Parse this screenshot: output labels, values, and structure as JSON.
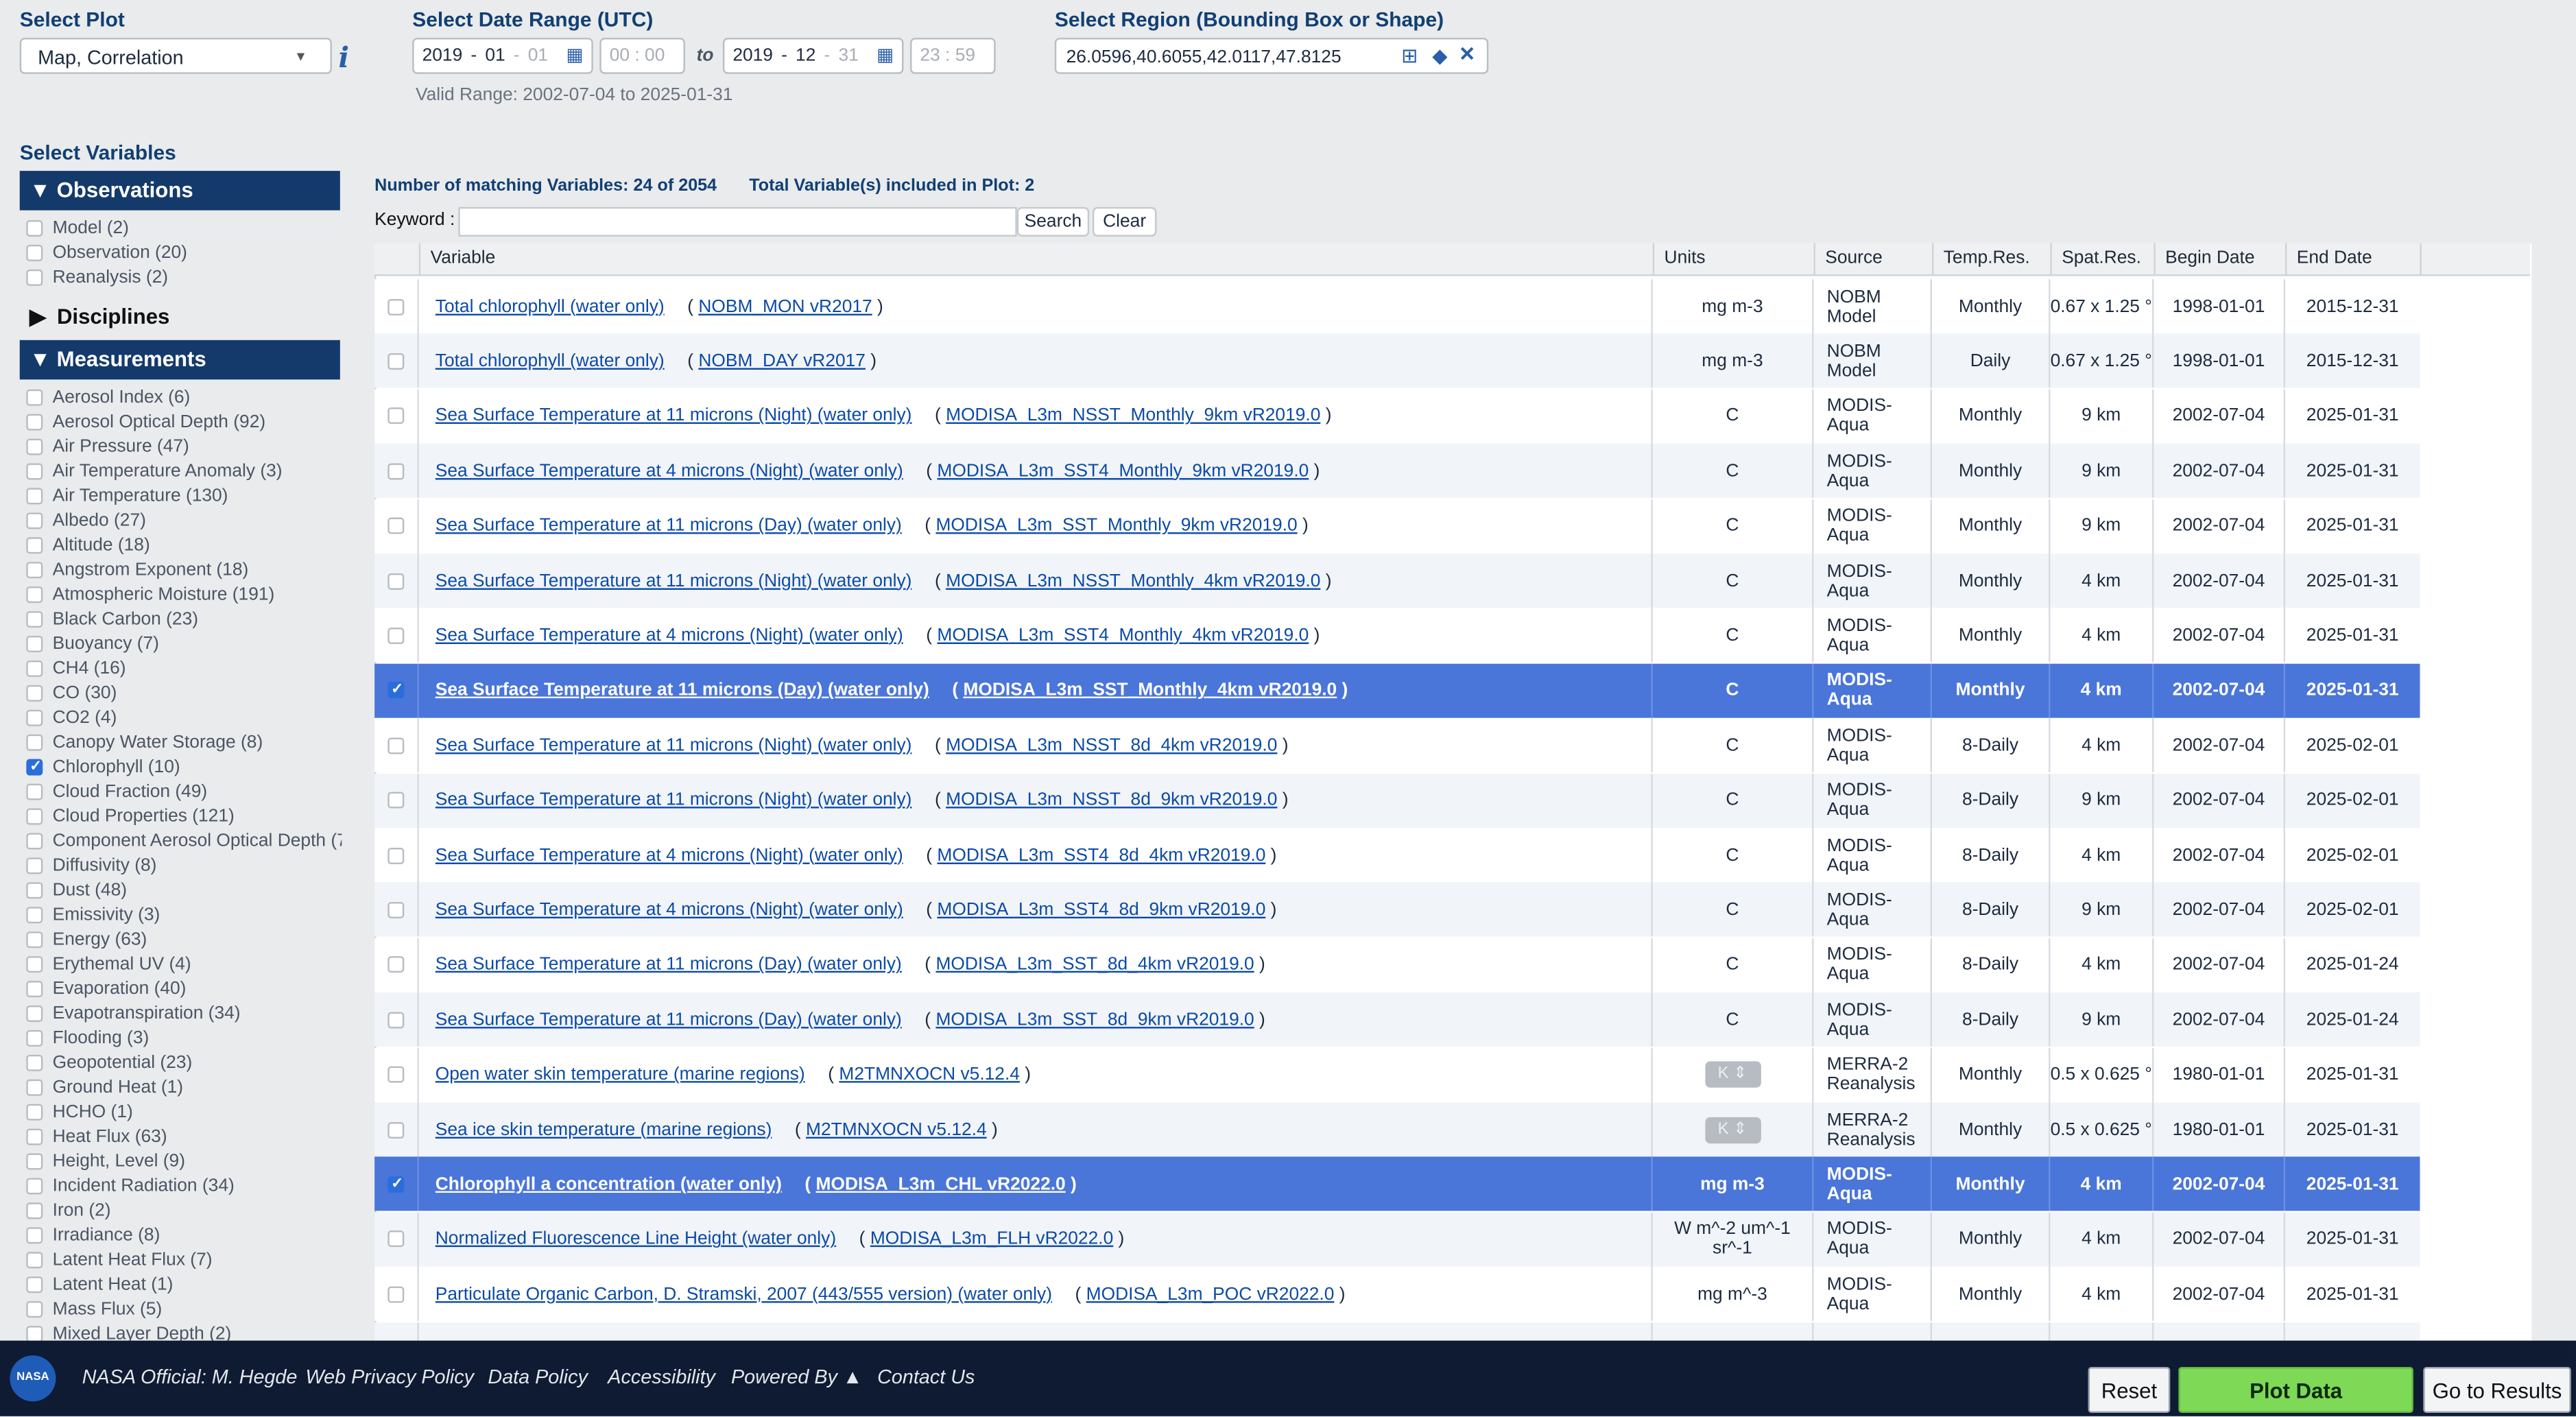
{
  "header": {
    "select_plot_label": "Select Plot",
    "plot_value": "Map, Correlation",
    "date_range_label": "Select Date Range (UTC)",
    "start": {
      "year": "2019",
      "month": "01",
      "day": "01",
      "hh": "00",
      "mm": "00"
    },
    "to_label": "to",
    "end": {
      "year": "2019",
      "month": "12",
      "day": "31",
      "hh": "23",
      "mm": "59"
    },
    "valid_range": "Valid Range: 2002-07-04 to 2025-01-31",
    "region_label": "Select Region (Bounding Box or Shape)",
    "region_value": "26.0596,40.6055,42.0117,47.8125"
  },
  "sidebar": {
    "title": "Select Variables",
    "observations_header": "Observations",
    "observations": [
      {
        "label": "Model (2)",
        "checked": false
      },
      {
        "label": "Observation (20)",
        "checked": false
      },
      {
        "label": "Reanalysis (2)",
        "checked": false
      }
    ],
    "disciplines_header": "Disciplines",
    "measurements_header": "Measurements",
    "measurements": [
      {
        "label": "Aerosol Index (6)",
        "checked": false
      },
      {
        "label": "Aerosol Optical Depth (92)",
        "checked": false
      },
      {
        "label": "Air Pressure (47)",
        "checked": false
      },
      {
        "label": "Air Temperature Anomaly (3)",
        "checked": false
      },
      {
        "label": "Air Temperature (130)",
        "checked": false
      },
      {
        "label": "Albedo (27)",
        "checked": false
      },
      {
        "label": "Altitude (18)",
        "checked": false
      },
      {
        "label": "Angstrom Exponent (18)",
        "checked": false
      },
      {
        "label": "Atmospheric Moisture (191)",
        "checked": false
      },
      {
        "label": "Black Carbon (23)",
        "checked": false
      },
      {
        "label": "Buoyancy (7)",
        "checked": false
      },
      {
        "label": "CH4 (16)",
        "checked": false
      },
      {
        "label": "CO (30)",
        "checked": false
      },
      {
        "label": "CO2 (4)",
        "checked": false
      },
      {
        "label": "Canopy Water Storage (8)",
        "checked": false
      },
      {
        "label": "Chlorophyll (10)",
        "checked": true
      },
      {
        "label": "Cloud Fraction (49)",
        "checked": false
      },
      {
        "label": "Cloud Properties (121)",
        "checked": false
      },
      {
        "label": "Component Aerosol Optical Depth (7",
        "checked": false
      },
      {
        "label": "Diffusivity (8)",
        "checked": false
      },
      {
        "label": "Dust (48)",
        "checked": false
      },
      {
        "label": "Emissivity (3)",
        "checked": false
      },
      {
        "label": "Energy (63)",
        "checked": false
      },
      {
        "label": "Erythemal UV (4)",
        "checked": false
      },
      {
        "label": "Evaporation (40)",
        "checked": false
      },
      {
        "label": "Evapotranspiration (34)",
        "checked": false
      },
      {
        "label": "Flooding (3)",
        "checked": false
      },
      {
        "label": "Geopotential (23)",
        "checked": false
      },
      {
        "label": "Ground Heat (1)",
        "checked": false
      },
      {
        "label": "HCHO (1)",
        "checked": false
      },
      {
        "label": "Heat Flux (63)",
        "checked": false
      },
      {
        "label": "Height, Level (9)",
        "checked": false
      },
      {
        "label": "Incident Radiation (34)",
        "checked": false
      },
      {
        "label": "Iron (2)",
        "checked": false
      },
      {
        "label": "Irradiance (8)",
        "checked": false
      },
      {
        "label": "Latent Heat Flux (7)",
        "checked": false
      },
      {
        "label": "Latent Heat (1)",
        "checked": false
      },
      {
        "label": "Mass Flux (5)",
        "checked": false
      },
      {
        "label": "Mixed Layer Depth (2)",
        "checked": false
      }
    ]
  },
  "results": {
    "matching": "Number of matching Variables: 24 of 2054",
    "total": "Total Variable(s) included in Plot: 2",
    "keyword_label": "Keyword :",
    "keyword_value": "",
    "search_label": "Search",
    "clear_label": "Clear",
    "columns": [
      "Variable",
      "Units",
      "Source",
      "Temp.Res.",
      "Spat.Res.",
      "Begin Date",
      "End Date"
    ],
    "rows": [
      {
        "sel": false,
        "variable": "Total chlorophyll (water only)",
        "dataset": "NOBM_MON vR2017",
        "units": "mg m-3",
        "unit_btn": false,
        "source": "NOBM Model",
        "temp": "Monthly",
        "spat": "0.67 x 1.25 °",
        "begin": "1998-01-01",
        "end": "2015-12-31"
      },
      {
        "sel": false,
        "variable": "Total chlorophyll (water only)",
        "dataset": "NOBM_DAY vR2017",
        "units": "mg m-3",
        "unit_btn": false,
        "source": "NOBM Model",
        "temp": "Daily",
        "spat": "0.67 x 1.25 °",
        "begin": "1998-01-01",
        "end": "2015-12-31"
      },
      {
        "sel": false,
        "variable": "Sea Surface Temperature at 11 microns (Night) (water only)",
        "dataset": "MODISA_L3m_NSST_Monthly_9km vR2019.0",
        "units": "C",
        "unit_btn": false,
        "source": "MODIS-Aqua",
        "temp": "Monthly",
        "spat": "9 km",
        "begin": "2002-07-04",
        "end": "2025-01-31"
      },
      {
        "sel": false,
        "variable": "Sea Surface Temperature at 4 microns (Night) (water only)",
        "dataset": "MODISA_L3m_SST4_Monthly_9km vR2019.0",
        "units": "C",
        "unit_btn": false,
        "source": "MODIS-Aqua",
        "temp": "Monthly",
        "spat": "9 km",
        "begin": "2002-07-04",
        "end": "2025-01-31"
      },
      {
        "sel": false,
        "variable": "Sea Surface Temperature at 11 microns (Day) (water only)",
        "dataset": "MODISA_L3m_SST_Monthly_9km vR2019.0",
        "units": "C",
        "unit_btn": false,
        "source": "MODIS-Aqua",
        "temp": "Monthly",
        "spat": "9 km",
        "begin": "2002-07-04",
        "end": "2025-01-31"
      },
      {
        "sel": false,
        "variable": "Sea Surface Temperature at 11 microns (Night) (water only)",
        "dataset": "MODISA_L3m_NSST_Monthly_4km vR2019.0",
        "units": "C",
        "unit_btn": false,
        "source": "MODIS-Aqua",
        "temp": "Monthly",
        "spat": "4 km",
        "begin": "2002-07-04",
        "end": "2025-01-31"
      },
      {
        "sel": false,
        "variable": "Sea Surface Temperature at 4 microns (Night) (water only)",
        "dataset": "MODISA_L3m_SST4_Monthly_4km vR2019.0",
        "units": "C",
        "unit_btn": false,
        "source": "MODIS-Aqua",
        "temp": "Monthly",
        "spat": "4 km",
        "begin": "2002-07-04",
        "end": "2025-01-31"
      },
      {
        "sel": true,
        "variable": "Sea Surface Temperature at 11 microns (Day) (water only)",
        "dataset": "MODISA_L3m_SST_Monthly_4km vR2019.0",
        "units": "C",
        "unit_btn": false,
        "source": "MODIS-Aqua",
        "temp": "Monthly",
        "spat": "4 km",
        "begin": "2002-07-04",
        "end": "2025-01-31"
      },
      {
        "sel": false,
        "variable": "Sea Surface Temperature at 11 microns (Night) (water only)",
        "dataset": "MODISA_L3m_NSST_8d_4km vR2019.0",
        "units": "C",
        "unit_btn": false,
        "source": "MODIS-Aqua",
        "temp": "8-Daily",
        "spat": "4 km",
        "begin": "2002-07-04",
        "end": "2025-02-01"
      },
      {
        "sel": false,
        "variable": "Sea Surface Temperature at 11 microns (Night) (water only)",
        "dataset": "MODISA_L3m_NSST_8d_9km vR2019.0",
        "units": "C",
        "unit_btn": false,
        "source": "MODIS-Aqua",
        "temp": "8-Daily",
        "spat": "9 km",
        "begin": "2002-07-04",
        "end": "2025-02-01"
      },
      {
        "sel": false,
        "variable": "Sea Surface Temperature at 4 microns (Night) (water only)",
        "dataset": "MODISA_L3m_SST4_8d_4km vR2019.0",
        "units": "C",
        "unit_btn": false,
        "source": "MODIS-Aqua",
        "temp": "8-Daily",
        "spat": "4 km",
        "begin": "2002-07-04",
        "end": "2025-02-01"
      },
      {
        "sel": false,
        "variable": "Sea Surface Temperature at 4 microns (Night) (water only)",
        "dataset": "MODISA_L3m_SST4_8d_9km vR2019.0",
        "units": "C",
        "unit_btn": false,
        "source": "MODIS-Aqua",
        "temp": "8-Daily",
        "spat": "9 km",
        "begin": "2002-07-04",
        "end": "2025-02-01"
      },
      {
        "sel": false,
        "variable": "Sea Surface Temperature at 11 microns (Day) (water only)",
        "dataset": "MODISA_L3m_SST_8d_4km vR2019.0",
        "units": "C",
        "unit_btn": false,
        "source": "MODIS-Aqua",
        "temp": "8-Daily",
        "spat": "4 km",
        "begin": "2002-07-04",
        "end": "2025-01-24"
      },
      {
        "sel": false,
        "variable": "Sea Surface Temperature at 11 microns (Day) (water only)",
        "dataset": "MODISA_L3m_SST_8d_9km vR2019.0",
        "units": "C",
        "unit_btn": false,
        "source": "MODIS-Aqua",
        "temp": "8-Daily",
        "spat": "9 km",
        "begin": "2002-07-04",
        "end": "2025-01-24"
      },
      {
        "sel": false,
        "variable": "Open water skin temperature (marine regions)",
        "dataset": "M2TMNXOCN v5.12.4",
        "units": "K",
        "unit_btn": true,
        "source": "MERRA-2 Reanalysis",
        "temp": "Monthly",
        "spat": "0.5 x 0.625 °",
        "begin": "1980-01-01",
        "end": "2025-01-31"
      },
      {
        "sel": false,
        "variable": "Sea ice skin temperature (marine regions)",
        "dataset": "M2TMNXOCN v5.12.4",
        "units": "K",
        "unit_btn": true,
        "source": "MERRA-2 Reanalysis",
        "temp": "Monthly",
        "spat": "0.5 x 0.625 °",
        "begin": "1980-01-01",
        "end": "2025-01-31"
      },
      {
        "sel": true,
        "variable": "Chlorophyll a concentration (water only)",
        "dataset": "MODISA_L3m_CHL vR2022.0",
        "units": "mg m-3",
        "unit_btn": false,
        "source": "MODIS-Aqua",
        "temp": "Monthly",
        "spat": "4 km",
        "begin": "2002-07-04",
        "end": "2025-01-31"
      },
      {
        "sel": false,
        "variable": "Normalized Fluorescence Line Height (water only)",
        "dataset": "MODISA_L3m_FLH vR2022.0",
        "units": "W m^-2 um^-1 sr^-1",
        "unit_btn": false,
        "source": "MODIS-Aqua",
        "temp": "Monthly",
        "spat": "4 km",
        "begin": "2002-07-04",
        "end": "2025-01-31"
      },
      {
        "sel": false,
        "variable": "Particulate Organic Carbon, D. Stramski, 2007 (443/555 version) (water only)",
        "dataset": "MODISA_L3m_POC vR2022.0",
        "units": "mg m^-3",
        "unit_btn": false,
        "source": "MODIS-Aqua",
        "temp": "Monthly",
        "spat": "4 km",
        "begin": "2002-07-04",
        "end": "2025-01-31"
      },
      {
        "sel": false,
        "variable": "",
        "dataset": "",
        "units": "",
        "unit_btn": false,
        "source": "MODIS-",
        "temp": "",
        "spat": "",
        "begin": "",
        "end": ""
      }
    ]
  },
  "footer": {
    "logo": "NASA",
    "official": "NASA Official: M. Hegde",
    "privacy": "Web Privacy Policy",
    "data_policy": "Data Policy",
    "accessibility": "Accessibility",
    "powered_by": "Powered By ▲",
    "contact": "Contact Us",
    "reset": "Reset",
    "plot_data": "Plot Data",
    "go_results": "Go to Results"
  }
}
